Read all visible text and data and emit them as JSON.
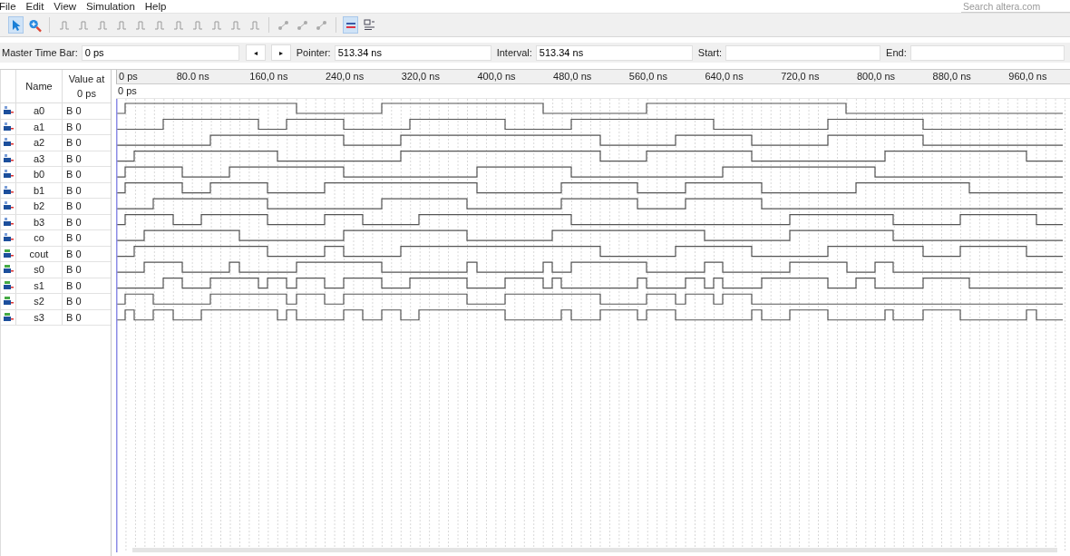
{
  "menu": [
    "File",
    "Edit",
    "View",
    "Simulation",
    "Help"
  ],
  "search": {
    "placeholder": "Search altera.com"
  },
  "toolbar_groups": [
    {
      "tools": [
        {
          "kind": "pointer",
          "selected": true
        },
        {
          "kind": "zoom",
          "selected": false
        }
      ]
    },
    {
      "tools": [
        {
          "kind": "edit",
          "selected": false
        },
        {
          "kind": "edit",
          "selected": false
        },
        {
          "kind": "edit",
          "selected": false
        },
        {
          "kind": "edit",
          "selected": false
        },
        {
          "kind": "edit",
          "selected": false
        },
        {
          "kind": "edit",
          "selected": false
        },
        {
          "kind": "edit",
          "selected": false
        },
        {
          "kind": "edit",
          "selected": false
        },
        {
          "kind": "edit",
          "selected": false
        },
        {
          "kind": "edit",
          "selected": false
        },
        {
          "kind": "edit",
          "selected": false
        }
      ]
    },
    {
      "tools": [
        {
          "kind": "node",
          "selected": false
        },
        {
          "kind": "node",
          "selected": false
        },
        {
          "kind": "node",
          "selected": false
        }
      ]
    },
    {
      "tools": [
        {
          "kind": "snap",
          "selected": true
        },
        {
          "kind": "grid",
          "selected": false
        }
      ]
    }
  ],
  "master_time_bar": {
    "label": "Master Time Bar:",
    "value": "0 ps"
  },
  "nav": [
    "◂",
    "▸"
  ],
  "fields": [
    {
      "label": "Pointer:",
      "value": "513.34 ns"
    },
    {
      "label": "Interval:",
      "value": "513.34 ns"
    },
    {
      "label": "Start:"
    },
    {
      "label": "End:"
    }
  ],
  "columns": {
    "name": "Name",
    "value": "Value at 0 ps"
  },
  "ruler": [
    "0 ps",
    "80.0 ns",
    "160,0 ns",
    "240,0 ns",
    "320,0 ns",
    "400,0 ns",
    "480,0 ns",
    "560,0 ns",
    "640,0 ns",
    "720,0 ns",
    "800,0 ns",
    "880,0 ns",
    "960,0 ns"
  ],
  "cursor_label": "0 ps",
  "signals": [
    {
      "name": "a0",
      "value": "B 0",
      "kind": "input"
    },
    {
      "name": "a1",
      "value": "B 0",
      "kind": "input"
    },
    {
      "name": "a2",
      "value": "B 0",
      "kind": "input"
    },
    {
      "name": "a3",
      "value": "B 0",
      "kind": "input"
    },
    {
      "name": "b0",
      "value": "B 0",
      "kind": "input"
    },
    {
      "name": "b1",
      "value": "B 0",
      "kind": "input"
    },
    {
      "name": "b2",
      "value": "B 0",
      "kind": "input"
    },
    {
      "name": "b3",
      "value": "B 0",
      "kind": "input"
    },
    {
      "name": "co",
      "value": "B 0",
      "kind": "input"
    },
    {
      "name": "cout",
      "value": "B 0",
      "kind": "output"
    },
    {
      "name": "s0",
      "value": "B 0",
      "kind": "output"
    },
    {
      "name": "s1",
      "value": "B 0",
      "kind": "output"
    },
    {
      "name": "s2",
      "value": "B 0",
      "kind": "output"
    },
    {
      "name": "s3",
      "value": "B 0",
      "kind": "output"
    }
  ]
}
